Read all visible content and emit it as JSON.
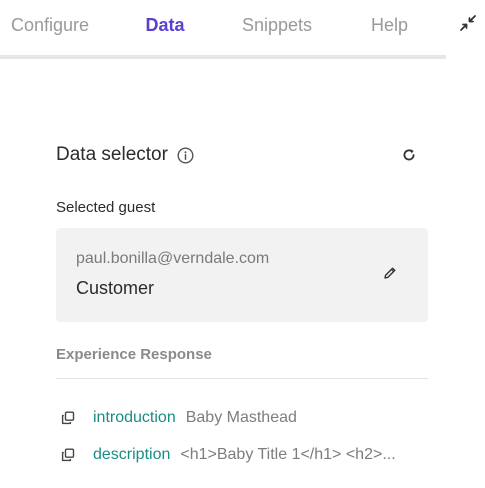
{
  "tabs": [
    {
      "label": "Configure",
      "active": false
    },
    {
      "label": "Data",
      "active": true
    },
    {
      "label": "Snippets",
      "active": false
    },
    {
      "label": "Help",
      "active": false
    }
  ],
  "accent_color": "#5b3fd1",
  "key_color": "#1b8c85",
  "icons": {
    "collapse": "collapse-arrows-icon",
    "info": "info-icon",
    "refresh": "refresh-icon",
    "edit": "pencil-icon",
    "copy": "copy-icon"
  },
  "data_selector": {
    "title": "Data selector",
    "guest_label": "Selected guest",
    "guest": {
      "email": "paul.bonilla@verndale.com",
      "type": "Customer"
    }
  },
  "experience_response": {
    "title": "Experience Response",
    "items": [
      {
        "key": "introduction",
        "value": "Baby Masthead"
      },
      {
        "key": "description",
        "value": "<h1>Baby Title 1</h1> <h2>..."
      }
    ]
  }
}
